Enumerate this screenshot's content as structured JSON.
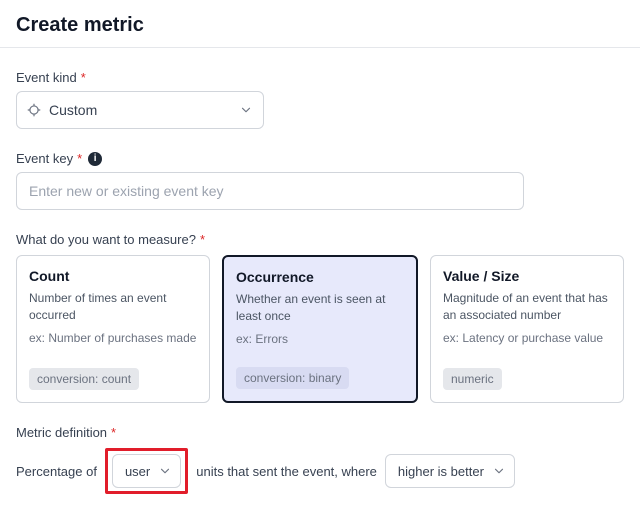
{
  "header": {
    "title": "Create metric"
  },
  "event_kind": {
    "label": "Event kind",
    "required": "*",
    "value": "Custom"
  },
  "event_key": {
    "label": "Event key",
    "required": "*",
    "placeholder": "Enter new or existing event key"
  },
  "measure": {
    "label": "What do you want to measure?",
    "required": "*",
    "cards": [
      {
        "title": "Count",
        "desc": "Number of times an event occurred",
        "ex": "ex: Number of purchases made",
        "badge": "conversion: count"
      },
      {
        "title": "Occurrence",
        "desc": "Whether an event is seen at least once",
        "ex": "ex: Errors",
        "badge": "conversion: binary"
      },
      {
        "title": "Value / Size",
        "desc": "Magnitude of an event that has an associated number",
        "ex": "ex: Latency or purchase value",
        "badge": "numeric"
      }
    ]
  },
  "metric_def": {
    "label": "Metric definition",
    "required": "*",
    "text_prefix": "Percentage of",
    "unit_select": "user",
    "text_middle": "units that sent the event, where",
    "direction_select": "higher is better"
  }
}
